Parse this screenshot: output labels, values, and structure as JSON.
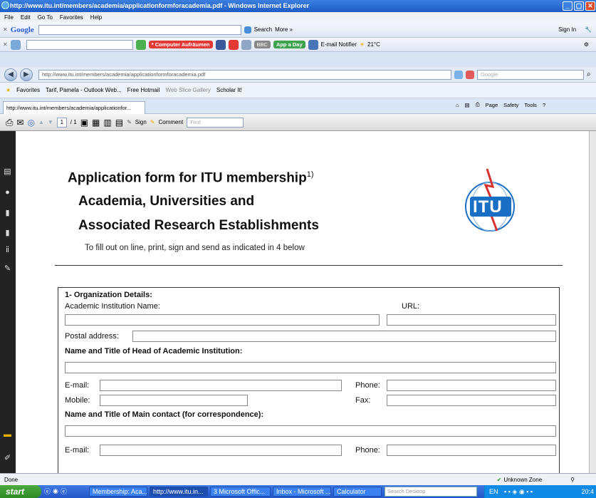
{
  "window": {
    "title": "http://www.itu.int/members/academia/applicationformforacademia.pdf - Windows Internet Explorer",
    "min_label": "_",
    "max_label": "▢",
    "close_label": "✕"
  },
  "menu": [
    "File",
    "Edit",
    "Go To",
    "Favorites",
    "Help"
  ],
  "google_bar": {
    "logo": "Google",
    "search_label": "Search",
    "more_label": "More »",
    "signin_label": "Sign In"
  },
  "toolbar2": {
    "cleanup_label": "* Computer Aufräumen",
    "appaday_label": "App a Day",
    "email_notifier_label": "E-mail Notifier",
    "temperature": "21°C",
    "bbc_label": "BBC"
  },
  "address": {
    "url": "http://www.itu.int/members/academia/applicationformforacademia.pdf",
    "search_placeholder": "Google"
  },
  "favorites": {
    "label": "Favorites",
    "items": [
      "Tarif, Pamela - Outlook Web...",
      "Free Hotmail",
      "Web Slice Gallery",
      "Scholar It!"
    ]
  },
  "tab": {
    "label": "http://www.itu.int/members/academia/applicationfor...",
    "page_label": "Page",
    "safety_label": "Safety",
    "tools_label": "Tools"
  },
  "pdf_toolbar": {
    "page_current": "1",
    "page_total": "/ 1",
    "sign_label": "Sign",
    "comment_label": "Comment",
    "find_placeholder": "Find"
  },
  "document": {
    "title": "Application form for ITU membership",
    "title_sup": "1)",
    "subtitle1": "Academia, Universities and",
    "subtitle2": "Associated Research Establishments",
    "instructions": "To fill out on line, print, sign and send as indicated in 4 below",
    "logo_text": "ITU",
    "section1": "1- Organization Details:",
    "institution_label": "Academic Institution Name:",
    "url_label": "URL:",
    "postal_label": "Postal address:",
    "head_label": "Name and Title of Head of Academic Institution:",
    "email_label": "E-mail:",
    "phone_label": "Phone:",
    "mobile_label": "Mobile:",
    "fax_label": "Fax:",
    "contact_label": "Name and Title of Main contact (for correspondence):",
    "email2_label": "E-mail:",
    "phone2_label": "Phone:"
  },
  "status": {
    "left": "Done",
    "zone": "Unknown Zone"
  },
  "taskbar": {
    "start": "start",
    "tasks": [
      "Membership: Aca...",
      "http://www.itu.in...",
      "3 Microsoft Offic...",
      "Inbox - Microsoft ...",
      "Calculator"
    ],
    "desktop_search": "Search Desktop",
    "lang": "EN",
    "clock": "20:4"
  },
  "colors": {
    "accent": "#2456c7",
    "itu_blue": "#1a6fc4",
    "itu_red": "#d8322f"
  }
}
